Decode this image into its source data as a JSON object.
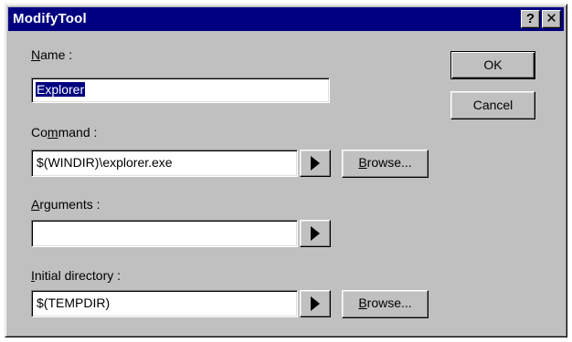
{
  "window": {
    "title": "ModifyTool",
    "help_label": "?",
    "close_label": "✕"
  },
  "name": {
    "label_key": "N",
    "label_rest": "ame :",
    "value": "Explorer"
  },
  "command": {
    "label_pre": "Co",
    "label_key": "m",
    "label_rest": "mand :",
    "value": "$(WINDIR)\\explorer.exe",
    "browse_key": "B",
    "browse_rest": "rowse..."
  },
  "arguments": {
    "label_key": "A",
    "label_rest": "rguments :",
    "value": ""
  },
  "initial_directory": {
    "label_key": "I",
    "label_rest": "nitial directory :",
    "value": "$(TEMPDIR)",
    "browse_key": "B",
    "browse_rest": "rowse..."
  },
  "buttons": {
    "ok_label": "OK",
    "cancel_label": "Cancel"
  }
}
